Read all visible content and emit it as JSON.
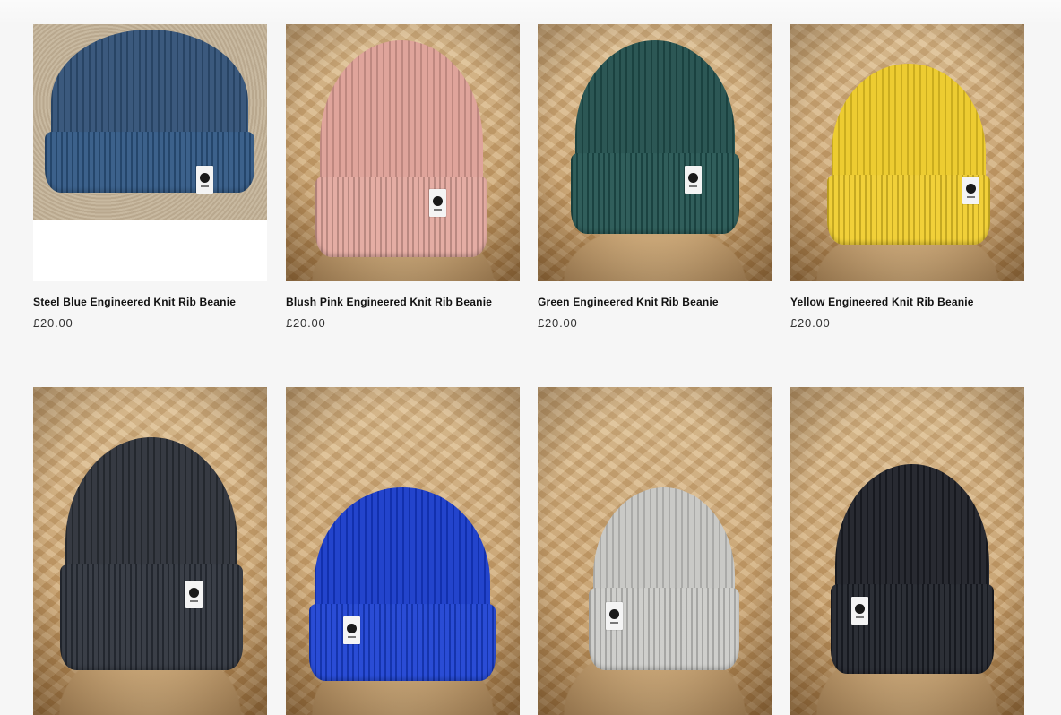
{
  "products": [
    {
      "name": "Steel Blue Engineered Knit Rib Beanie",
      "price": "£20.00",
      "color": "#2c4a6e",
      "image": "beanie-steel-blue"
    },
    {
      "name": "Blush Pink Engineered Knit Rib Beanie",
      "price": "£20.00",
      "color": "#dd9e95",
      "image": "beanie-blush-pink"
    },
    {
      "name": "Green Engineered Knit Rib Beanie",
      "price": "£20.00",
      "color": "#1f4d4a",
      "image": "beanie-green"
    },
    {
      "name": "Yellow Engineered Knit Rib Beanie",
      "price": "£20.00",
      "color": "#ecc924",
      "image": "beanie-yellow"
    },
    {
      "name": "",
      "price": "",
      "color": "#2a2e36",
      "image": "beanie-charcoal-waffle"
    },
    {
      "name": "",
      "price": "",
      "color": "#1538c9",
      "image": "beanie-royal-blue"
    },
    {
      "name": "",
      "price": "",
      "color": "#c6c6c3",
      "image": "beanie-light-grey"
    },
    {
      "name": "",
      "price": "",
      "color": "#1b1d24",
      "image": "beanie-black"
    }
  ]
}
